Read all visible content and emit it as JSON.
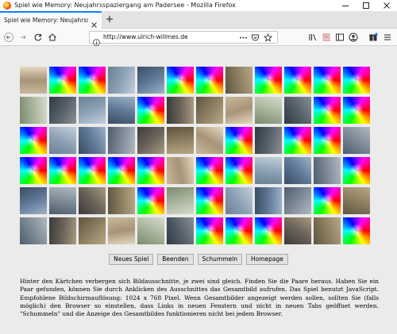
{
  "window": {
    "title": "Spiel wie Memory: Neujahrsspaziergang am Padersee - Mozilla Firefox"
  },
  "tabs": [
    {
      "label": "Spiel wie Memory: Neujahrsspazier",
      "active": true
    }
  ],
  "navbar": {
    "url": "http://www.ulrich-willmes.de"
  },
  "icons": {
    "favicon": "firefox-icon",
    "minimize": "minimize-icon",
    "maximize": "maximize-icon",
    "close": "close-icon",
    "tab_close": "close-icon",
    "new_tab": "plus-icon",
    "back": "back-arrow-icon",
    "forward": "forward-arrow-icon",
    "reload": "reload-icon",
    "home": "home-icon",
    "site_info": "info-icon",
    "page_actions": "more-horizontal-icon",
    "pocket": "pocket-icon",
    "bookmark": "star-icon",
    "library": "library-icon",
    "reader": "reader-view-icon",
    "sidebar": "sidebar-icon",
    "account": "account-icon",
    "extensions": "extensions-icon",
    "menu": "hamburger-menu-icon"
  },
  "colors": {
    "accent": "#0a84ff",
    "page_background": "#ebebeb"
  },
  "memory": {
    "columns": 12,
    "rows": 6,
    "cards": [
      "photo",
      "back",
      "back",
      "photo",
      "photo",
      "back",
      "back",
      "photo",
      "back",
      "back",
      "back",
      "back",
      "photo",
      "photo",
      "photo",
      "photo",
      "back",
      "photo",
      "photo",
      "photo",
      "photo",
      "photo",
      "back",
      "back",
      "back",
      "photo",
      "photo",
      "photo",
      "photo",
      "photo",
      "photo",
      "back",
      "photo",
      "back",
      "back",
      "photo",
      "back",
      "back",
      "back",
      "back",
      "back",
      "photo",
      "back",
      "back",
      "photo",
      "photo",
      "photo",
      "back",
      "photo",
      "photo",
      "photo",
      "photo",
      "back",
      "photo",
      "back",
      "photo",
      "photo",
      "photo",
      "back",
      "photo",
      "photo",
      "photo",
      "photo",
      "photo",
      "photo",
      "photo",
      "back",
      "back",
      "back",
      "photo",
      "photo",
      "back"
    ]
  },
  "buttons": {
    "new_game": "Neues Spiel",
    "quit": "Beenden",
    "shuffle": "Schummeln",
    "homepage": "Homepage"
  },
  "description": "Hinter den Kärtchen verbergen sich Bildausschnitte, je zwei sind gleich. Finden Sie die Paare heraus. Haben Sie ein Paar gefunden, können Sie durch Anklicken des Ausschnittes das Gesamtbild aufrufen. Das Spiel benutzt JavaScript. Empfohlene Bildschirmauflösung: 1024 x 768 Pixel. Wenn Gesamtbilder angezeigt werden sollen, sollten Sie (falls möglich) den Browser so einstellen, dass Links in neuen Fenstern und nicht in neuen Tabs geöffnet werden. \"Schummeln\" und die Anzeige des Gesamtbildes funktionieren nicht bei jedem Browser."
}
